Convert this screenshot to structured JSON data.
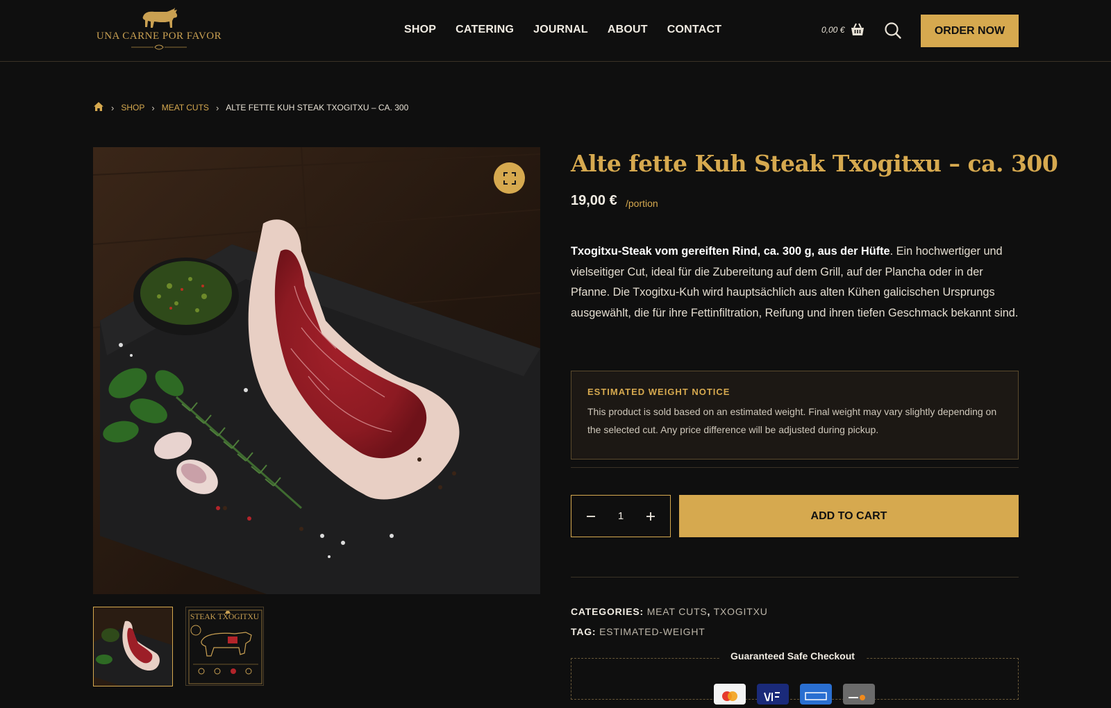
{
  "header": {
    "logo_text": "UNA CARNE POR FAVOR",
    "nav": [
      "SHOP",
      "CATERING",
      "JOURNAL",
      "ABOUT",
      "CONTACT"
    ],
    "cart_total": "0,00 €",
    "order_button": "ORDER NOW"
  },
  "breadcrumb": {
    "items": [
      "SHOP",
      "MEAT CUTS"
    ],
    "current": "ALTE FETTE KUH STEAK TXOGITXU – CA. 300"
  },
  "gallery": {
    "thumb2_title": "STEAK TXOGITXU"
  },
  "product": {
    "title": "Alte fette Kuh Steak Txogitxu – ca. 300",
    "price": "19,00 €",
    "price_unit": "/portion",
    "description_bold": "Txogitxu-Steak vom gereiften Rind, ca. 300 g, aus der Hüfte",
    "description_rest": ". Ein hochwertiger und vielseitiger Cut, ideal für die Zubereitung auf dem Grill, auf der Plancha oder in der Pfanne. Die Txogitxu-Kuh wird hauptsächlich aus alten Kühen galicischen Ursprungs ausgewählt, die für ihre Fettinfiltration, Reifung und ihren tiefen Geschmack bekannt sind.",
    "quantity": "1",
    "add_to_cart": "ADD TO CART"
  },
  "notice": {
    "title": "ESTIMATED WEIGHT NOTICE",
    "text": "This product is sold based on an estimated weight. Final weight may vary slightly depending on the selected cut. Any price difference will be adjusted during pickup."
  },
  "meta": {
    "categories_label": "CATEGORIES:",
    "categories": [
      "MEAT CUTS",
      "TXOGITXU"
    ],
    "tag_label": "TAG:",
    "tag": "ESTIMATED-WEIGHT"
  },
  "checkout": {
    "title": "Guaranteed Safe Checkout",
    "cards": [
      "mastercard",
      "visa",
      "amex",
      "discover"
    ]
  },
  "colors": {
    "accent": "#d6a94f",
    "background": "#0f0f0f"
  }
}
